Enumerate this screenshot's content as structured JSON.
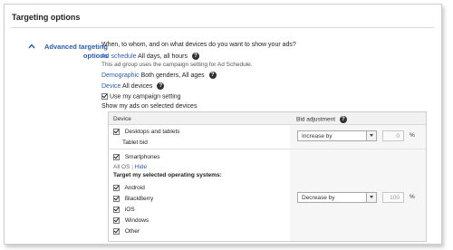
{
  "panel": {
    "title": "Targeting options"
  },
  "side": {
    "toggle_line1": "Advanced targeting",
    "toggle_line2": "options"
  },
  "intro": "When, to whom, and on what devices do you want to show your ads?",
  "ad_schedule": {
    "label": "Ad schedule",
    "value": "All days, all hours",
    "note": "This ad group uses the campaign setting for Ad Schedule."
  },
  "demographic": {
    "label": "Demographic",
    "value": "Both genders, All ages"
  },
  "device": {
    "label": "Device",
    "value": "All devices"
  },
  "use_campaign_setting": "Use my campaign setting",
  "show_on_selected": "Show my ads on selected devices",
  "grid": {
    "col_device": "Device",
    "col_bid": "Bid adjustment",
    "desktop": {
      "label": "Desktops and tablets",
      "sub": "Tablet bid",
      "mode": "Increase by",
      "value": "0",
      "unit": "%"
    },
    "smartphones": {
      "label": "Smartphones",
      "all_os": "All OS",
      "separator": "|",
      "hide": "Hide",
      "target_heading": "Target my selected operating systems:",
      "os": [
        "Android",
        "BlackBerry",
        "iOS",
        "Windows",
        "Other"
      ],
      "mode": "Decrease by",
      "value": "100",
      "unit": "%"
    }
  },
  "colors": {
    "link": "#2a5db0",
    "border": "#cfcfcf",
    "header_bg": "#f1f1f1"
  },
  "icons": [
    "chevron-up-icon",
    "help-icon",
    "checkbox-checked-icon",
    "dropdown-arrow-icon"
  ]
}
